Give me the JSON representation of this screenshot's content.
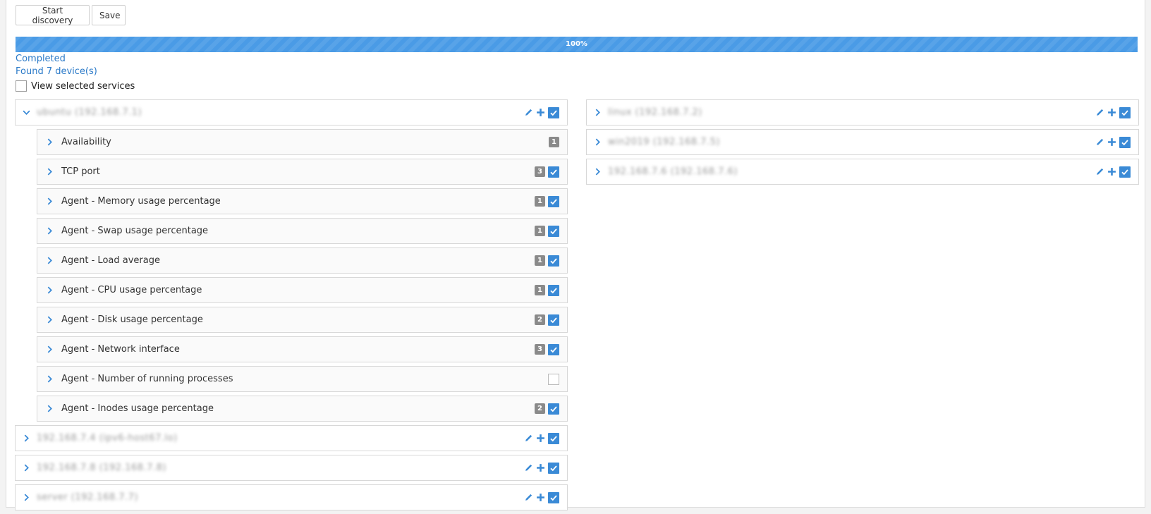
{
  "toolbar": {
    "start_label": "Start discovery",
    "save_label": "Save"
  },
  "progress": {
    "percent": 100,
    "label": "100%"
  },
  "status": {
    "state": "Completed",
    "found": "Found 7 device(s)"
  },
  "view_selected": {
    "label": "View selected services",
    "checked": false
  },
  "colors": {
    "accent": "#3a8ad6",
    "progress": "#4a9be6",
    "link": "#2b7ac8",
    "badge": "#8a8a8a"
  },
  "left_hosts": [
    {
      "name": "ubuntu (192.168.7.1)",
      "expanded": true,
      "checked": true,
      "services": [
        {
          "name": "Availability",
          "count": "1",
          "checked": null
        },
        {
          "name": "TCP port",
          "count": "3",
          "checked": true
        },
        {
          "name": "Agent - Memory usage percentage",
          "count": "1",
          "checked": true
        },
        {
          "name": "Agent - Swap usage percentage",
          "count": "1",
          "checked": true
        },
        {
          "name": "Agent - Load average",
          "count": "1",
          "checked": true
        },
        {
          "name": "Agent - CPU usage percentage",
          "count": "1",
          "checked": true
        },
        {
          "name": "Agent - Disk usage percentage",
          "count": "2",
          "checked": true
        },
        {
          "name": "Agent - Network interface",
          "count": "3",
          "checked": true
        },
        {
          "name": "Agent - Number of running processes",
          "count": "",
          "checked": false
        },
        {
          "name": "Agent - Inodes usage percentage",
          "count": "2",
          "checked": true
        }
      ]
    },
    {
      "name": "192.168.7.4 (ipv6-host67.lo)",
      "expanded": false,
      "checked": true
    },
    {
      "name": "192.168.7.8 (192.168.7.8)",
      "expanded": false,
      "checked": true
    },
    {
      "name": "server (192.168.7.7)",
      "expanded": false,
      "checked": true
    }
  ],
  "right_hosts": [
    {
      "name": "linux (192.168.7.2)",
      "expanded": false,
      "checked": true
    },
    {
      "name": "win2019 (192.168.7.5)",
      "expanded": false,
      "checked": true
    },
    {
      "name": "192.168.7.6 (192.168.7.6)",
      "expanded": false,
      "checked": true
    }
  ]
}
